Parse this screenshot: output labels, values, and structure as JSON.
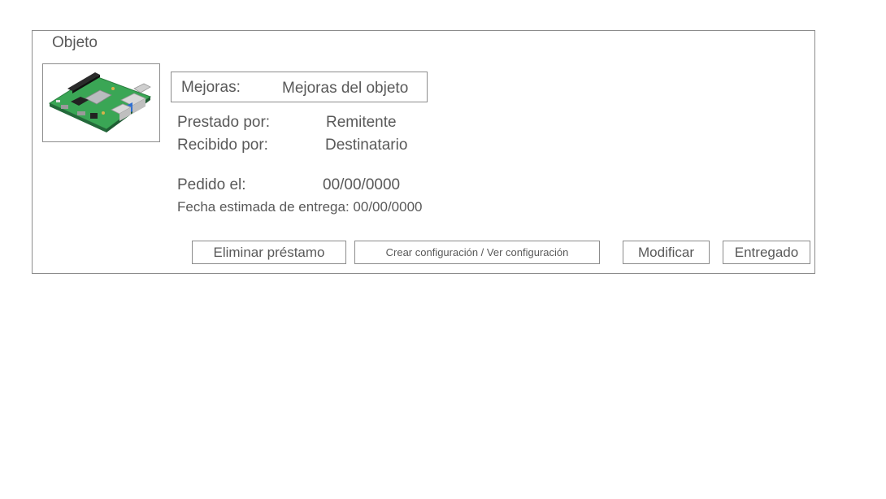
{
  "card": {
    "title": "Objeto",
    "image_icon": "raspberry-pi-board-image"
  },
  "mejoras": {
    "label": "Mejoras:",
    "value": "Mejoras del objeto"
  },
  "details": {
    "prestado_label": "Prestado por:",
    "prestado_value": "Remitente",
    "recibido_label": "Recibido por:",
    "recibido_value": "Destinatario",
    "pedido_label": "Pedido el:",
    "pedido_value": "00/00/0000",
    "fecha_estimada": "Fecha estimada de entrega: 00/00/0000"
  },
  "actions": {
    "eliminar": "Eliminar préstamo",
    "configuracion": "Crear configuración / Ver configuración",
    "modificar": "Modificar",
    "entregado": "Entregado"
  }
}
